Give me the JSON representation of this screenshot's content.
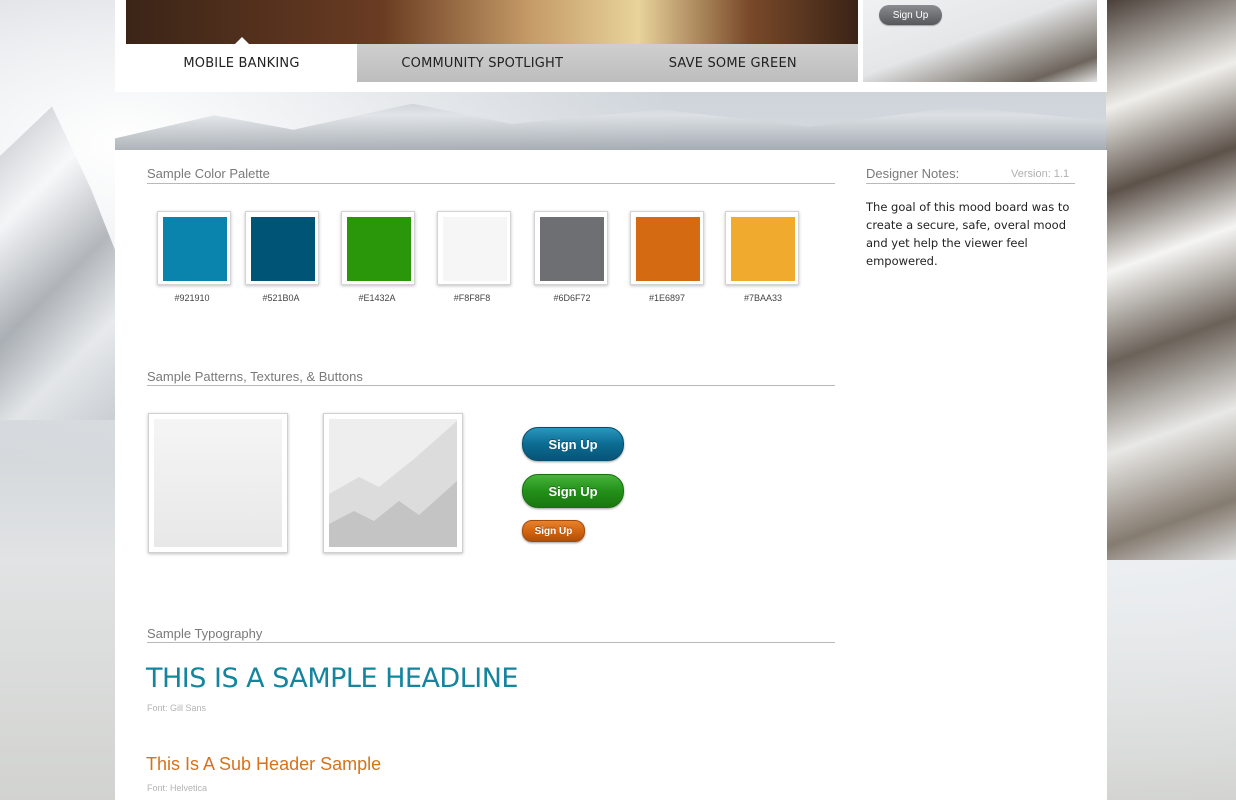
{
  "nav": {
    "tabs": [
      {
        "label": "MOBILE BANKING"
      },
      {
        "label": "COMMUNITY SPOTLIGHT"
      },
      {
        "label": "SAVE SOME GREEN"
      }
    ]
  },
  "header": {
    "signup_label": "Sign Up"
  },
  "palette": {
    "title": "Sample Color Palette",
    "swatches": [
      {
        "label": "#921910",
        "color": "#0a84ad"
      },
      {
        "label": "#521B0A",
        "color": "#005576"
      },
      {
        "label": "#E1432A",
        "color": "#2a970b"
      },
      {
        "label": "#F8F8F8",
        "color": "#f6f6f6"
      },
      {
        "label": "#6D6F72",
        "color": "#6d6f72"
      },
      {
        "label": "#1E6897",
        "color": "#d46a12"
      },
      {
        "label": "#7BAA33",
        "color": "#f0aa2e"
      }
    ]
  },
  "patterns": {
    "title": "Sample Patterns, Textures, & Buttons",
    "buttons": {
      "blue": "Sign Up",
      "green": "Sign Up",
      "orange": "Sign Up"
    }
  },
  "typography": {
    "title": "Sample Typography",
    "headline": "THIS IS A SAMPLE HEADLINE",
    "headline_font": "Font: Gill Sans",
    "subheader": "This Is A Sub Header Sample",
    "subheader_font": "Font: Helvetica"
  },
  "notes": {
    "title": "Designer Notes:",
    "version": "Version: 1.1",
    "body": "The goal of this mood board was to create a secure, safe, overal mood and yet help the viewer feel empowered."
  }
}
